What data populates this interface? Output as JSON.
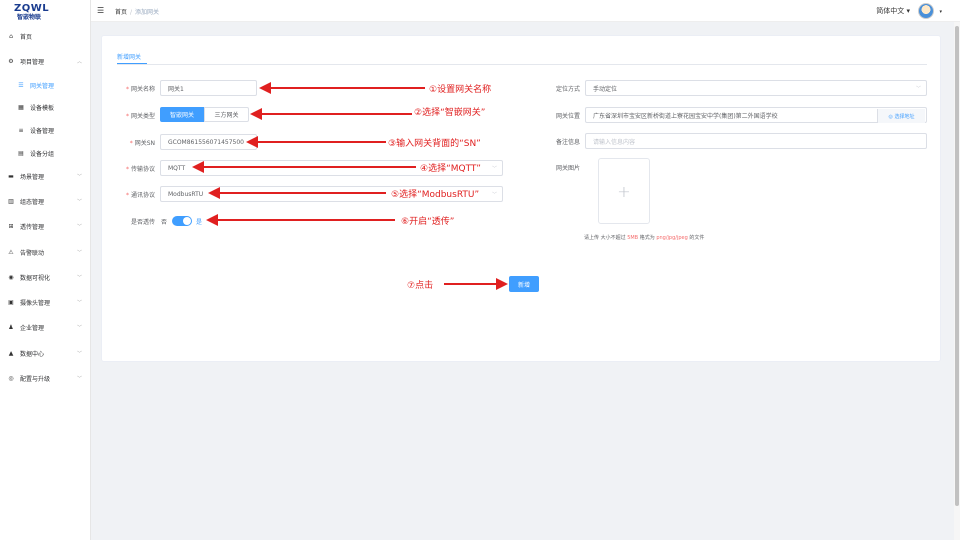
{
  "logo": {
    "mark": "ZQWL",
    "sub": "智嵌物联"
  },
  "sidebar": {
    "items": [
      {
        "icon": "home-icon",
        "glyph": "⌂",
        "label": "首页",
        "chevron": ""
      },
      {
        "icon": "gear-icon",
        "glyph": "⚙",
        "label": "项目管理",
        "chevron": "︿"
      },
      {
        "icon": "gateway-icon",
        "glyph": "☰",
        "label": "网关管理",
        "chevron": ""
      },
      {
        "icon": "grid-icon",
        "glyph": "▦",
        "label": "设备模板",
        "chevron": ""
      },
      {
        "icon": "list-icon",
        "glyph": "≡",
        "label": "设备管理",
        "chevron": ""
      },
      {
        "icon": "table-icon",
        "glyph": "▤",
        "label": "设备分组",
        "chevron": ""
      },
      {
        "icon": "scene-icon",
        "glyph": "▬",
        "label": "场景管理",
        "chevron": "﹀"
      },
      {
        "icon": "config-icon",
        "glyph": "▥",
        "label": "组态管理",
        "chevron": "﹀"
      },
      {
        "icon": "transmit-icon",
        "glyph": "⊞",
        "label": "透传管理",
        "chevron": "﹀"
      },
      {
        "icon": "alarm-icon",
        "glyph": "⚠",
        "label": "告警联动",
        "chevron": "﹀"
      },
      {
        "icon": "chart-icon",
        "glyph": "◉",
        "label": "数据可视化",
        "chevron": "﹀"
      },
      {
        "icon": "camera-icon",
        "glyph": "▣",
        "label": "摄像头管理",
        "chevron": "﹀"
      },
      {
        "icon": "user-icon",
        "glyph": "♟",
        "label": "企业管理",
        "chevron": "﹀"
      },
      {
        "icon": "data-icon",
        "glyph": "▲",
        "label": "数据中心",
        "chevron": "﹀"
      },
      {
        "icon": "upgrade-icon",
        "glyph": "◎",
        "label": "配置与升级",
        "chevron": "﹀"
      }
    ]
  },
  "header": {
    "breadcrumb_home": "首页",
    "breadcrumb_sep": "/",
    "breadcrumb_current": "添加网关",
    "language": "简体中文 ▾",
    "avatar_caret": "▾"
  },
  "card": {
    "tab": "新增网关"
  },
  "form": {
    "name_label": "网关名称",
    "name_value": "网关1",
    "type_label": "网关类型",
    "type_on": "智嵌网关",
    "type_off": "三方网关",
    "sn_label": "网关SN",
    "sn_value": "GCOM861556071457500",
    "transport_label": "传输协议",
    "transport_value": "MQTT",
    "comm_label": "通讯协议",
    "comm_value": "ModbusRTU",
    "passthrough_label": "是否透传",
    "passthrough_no": "否",
    "passthrough_yes": "是",
    "locate_label": "定位方式",
    "locate_value": "手动定位",
    "position_label": "网关位置",
    "position_value": "广东省深圳市宝安区新桥街道上寮花园宝安中学(集团)第二外国语学校",
    "locate_btn": "◎ 选择地址",
    "remark_label": "备注信息",
    "remark_placeholder": "请输入信息内容",
    "image_label": "网关图片",
    "upload_plus": "+",
    "upload_tip_a": "请上传 大小不超过 ",
    "upload_tip_size": "5MB",
    "upload_tip_b": " 格式为 ",
    "upload_tip_fmt": "png/jpg/jpeg",
    "upload_tip_c": " 的文件",
    "submit": "新增",
    "select_caret": "﹀"
  },
  "annotations": {
    "n1": "①设置网关名称",
    "n2": "②选择“智嵌网关”",
    "n3": "③输入网关背面的“SN”",
    "n4": "④选择“MQTT”",
    "n5": "⑤选择“ModbusRTU”",
    "n6": "⑥开启“透传”",
    "n7": "⑦点击"
  },
  "colors": {
    "primary": "#409eff",
    "annotation": "#e02020",
    "brand": "#1a3c8f"
  }
}
